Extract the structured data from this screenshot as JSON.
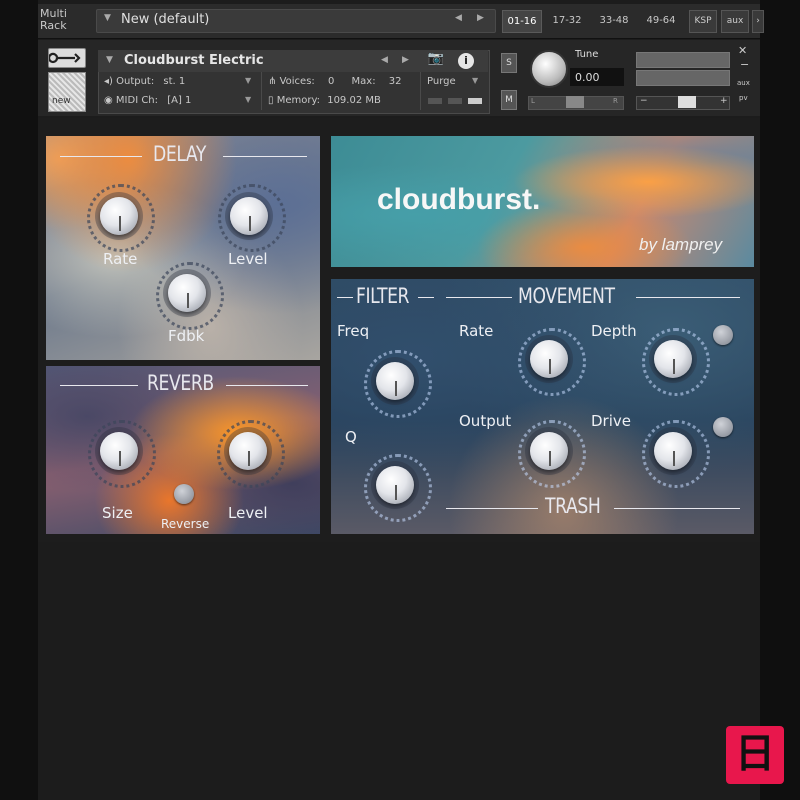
{
  "rack": {
    "multi_rack_label": "Multi\nRack",
    "preset_name": "New (default)",
    "page_tabs": [
      "01-16",
      "17-32",
      "33-48",
      "49-64"
    ],
    "ksp_label": "KSP",
    "aux_label": "aux"
  },
  "instrument": {
    "name": "Cloudburst Electric",
    "new_label": "new",
    "output_label": "Output:",
    "output_value": "st. 1",
    "midi_label": "MIDI Ch:",
    "midi_value": "[A] 1",
    "voices_label": "Voices:",
    "voices_value": "0",
    "max_label": "Max:",
    "max_value": "32",
    "memory_label": "Memory:",
    "memory_value": "109.02 MB",
    "purge_label": "Purge",
    "solo_label": "S",
    "mute_label": "M",
    "tune_label": "Tune",
    "tune_value": "0.00",
    "pan_left": "L",
    "pan_right": "R",
    "aux_small": "aux",
    "pv_small": "pv"
  },
  "delay": {
    "title": "DELAY",
    "rate": "Rate",
    "level": "Level",
    "fdbk": "Fdbk"
  },
  "reverb": {
    "title": "REVERB",
    "size": "Size",
    "reverse": "Reverse",
    "level": "Level"
  },
  "logo": {
    "title": "cloudburst.",
    "byline": "by lamprey"
  },
  "filter": {
    "title": "FILTER",
    "freq": "Freq",
    "q": "Q"
  },
  "movement": {
    "title": "MOVEMENT",
    "rate": "Rate",
    "depth": "Depth",
    "output": "Output",
    "drive": "Drive"
  },
  "trash": {
    "title": "TRASH"
  },
  "colors": {
    "accent_orange": "#f08c3c",
    "accent_teal": "#4c9aa0",
    "badge": "#e8174c"
  }
}
